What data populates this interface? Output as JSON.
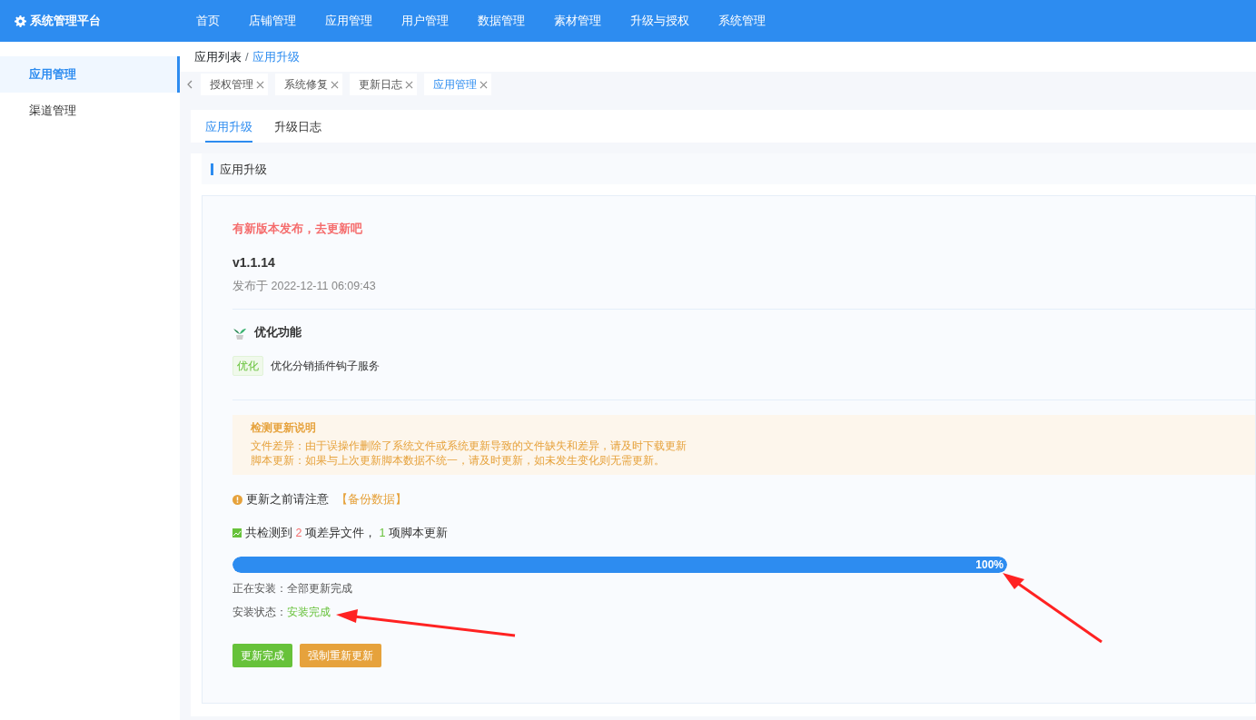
{
  "brand": {
    "title": "系统管理平台"
  },
  "top_nav": [
    {
      "label": "首页",
      "selected": false
    },
    {
      "label": "店铺管理",
      "selected": false
    },
    {
      "label": "应用管理",
      "selected": false
    },
    {
      "label": "用户管理",
      "selected": false
    },
    {
      "label": "数据管理",
      "selected": false
    },
    {
      "label": "素材管理",
      "selected": false
    },
    {
      "label": "升级与授权",
      "selected": false
    },
    {
      "label": "系统管理",
      "selected": false
    }
  ],
  "sidebar": {
    "items": [
      {
        "label": "应用管理",
        "selected": true
      },
      {
        "label": "渠道管理",
        "selected": false
      }
    ]
  },
  "breadcrumb": {
    "items": [
      "应用列表",
      "应用升级"
    ],
    "separator": "/"
  },
  "open_tabs": [
    {
      "label": "授权管理",
      "selected": false
    },
    {
      "label": "系统修复",
      "selected": false
    },
    {
      "label": "更新日志",
      "selected": false
    },
    {
      "label": "应用管理",
      "selected": true
    }
  ],
  "page_tabs": [
    {
      "label": "应用升级",
      "selected": true
    },
    {
      "label": "升级日志",
      "selected": false
    }
  ],
  "section_title": "应用升级",
  "release": {
    "notice": "有新版本发布，去更新吧",
    "version": "v1.1.14",
    "published": "发布于 2022-12-11 06:09:43",
    "feature_heading": "优化功能",
    "changes": [
      {
        "tag": "优化",
        "text": "优化分销插件钩子服务"
      }
    ]
  },
  "explain": {
    "title": "检测更新说明",
    "lines": [
      "文件差异：由于误操作删除了系统文件或系统更新导致的文件缺失和差异，请及时下载更新",
      "脚本更新：如果与上次更新脚本数据不统一，请及时更新，如未发生变化则无需更新。"
    ]
  },
  "warning": {
    "text": "更新之前请注意",
    "link": "【备份数据】"
  },
  "detect": {
    "prefix": "共检测到",
    "diff_count": "2",
    "mid": "项差异文件，",
    "script_count": "1",
    "suffix": "项脚本更新"
  },
  "progress": {
    "level": 1,
    "label": "100%"
  },
  "status": [
    {
      "label": "正在安装：",
      "value": "全部更新完成",
      "success": false
    },
    {
      "label": "安装状态：",
      "value": "安装完成",
      "success": true
    }
  ],
  "buttons": [
    {
      "label": "更新完成",
      "kind": "success"
    },
    {
      "label": "强制重新更新",
      "kind": "warning"
    }
  ]
}
